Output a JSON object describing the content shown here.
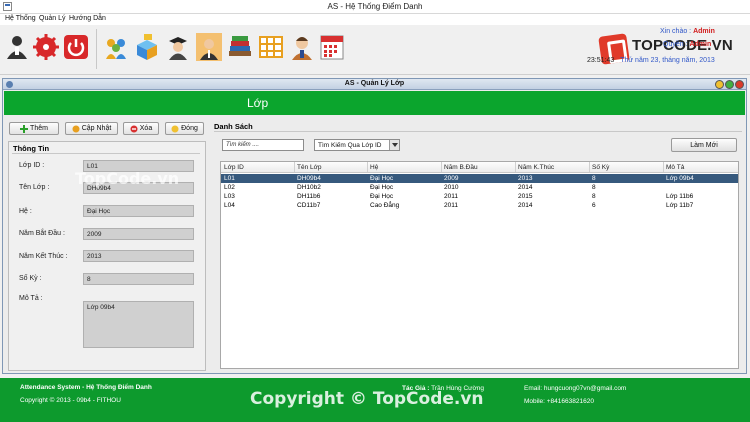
{
  "window": {
    "title": "AS - Hệ Thống Điểm Danh"
  },
  "menu": [
    "Hệ Thống",
    "Quản Lý",
    "Hướng Dẫn"
  ],
  "toolbar": {
    "group1": [
      {
        "name": "user-icon",
        "color": "#333333"
      },
      {
        "name": "settings-icon",
        "color": "#d8282a"
      },
      {
        "name": "power-icon",
        "color": "#d8282a"
      }
    ],
    "group2": [
      {
        "name": "users-group-icon",
        "color": "#e8a820"
      },
      {
        "name": "boxes-icon",
        "color": "#3a8ad8"
      },
      {
        "name": "student-icon",
        "color": "#444444"
      },
      {
        "name": "teacher-icon",
        "color": "#d88820"
      },
      {
        "name": "books-icon",
        "color": "#8a5a30"
      },
      {
        "name": "grid-table-icon",
        "color": "#e8a020"
      },
      {
        "name": "person-icon",
        "color": "#c07030"
      },
      {
        "name": "calendar-icon",
        "color": "#d83030"
      }
    ]
  },
  "brand": {
    "name": "TOPCODE.VN"
  },
  "greeting": {
    "hello_label": "Xin chào :",
    "hello_user": "Admin",
    "role_label": "Quyền :",
    "role_value": "Admin",
    "time": "23:51:43",
    "date": "Thứ năm  23, tháng năm,   2013"
  },
  "inner": {
    "title": "AS - Quản Lý Lớp",
    "heading": "Lớp"
  },
  "actions": {
    "add": "Thêm",
    "update": "Cập Nhật",
    "delete": "Xóa",
    "close": "Đóng"
  },
  "info": {
    "legend": "Thông Tin",
    "fields": [
      {
        "label": "Lớp ID :",
        "value": "L01"
      },
      {
        "label": "Tên Lớp :",
        "value": "DH09b4"
      },
      {
        "label": "Hệ :",
        "value": "Đại Học"
      },
      {
        "label": "Năm Bắt Đầu :",
        "value": "2009"
      },
      {
        "label": "Năm Kết Thúc :",
        "value": "2013"
      },
      {
        "label": "Số Kỳ :",
        "value": "8"
      },
      {
        "label": "Mô Tả :",
        "value": "Lớp 09b4"
      }
    ]
  },
  "list": {
    "title": "Danh Sách",
    "search_placeholder": "Tìm kiếm ....",
    "filter": "Tìm Kiếm Qua Lớp ID",
    "refresh": "Làm Mới",
    "columns": [
      "Lớp ID",
      "Tên Lớp",
      "Hệ",
      "Năm B.Đầu",
      "Năm K.Thúc",
      "Số Kỳ",
      "Mô Tả"
    ],
    "rows": [
      [
        "L01",
        "DH09b4",
        "Đại Học",
        "2009",
        "2013",
        "8",
        "Lớp 09b4"
      ],
      [
        "L02",
        "DH10b2",
        "Đại Học",
        "2010",
        "2014",
        "8",
        ""
      ],
      [
        "L03",
        "DH11b6",
        "Đại Học",
        "2011",
        "2015",
        "8",
        "Lớp 11b6"
      ],
      [
        "L04",
        "CD11b7",
        "Cao Đẳng",
        "2011",
        "2014",
        "6",
        "Lớp 11b7"
      ]
    ],
    "selected_row": 0
  },
  "footer": {
    "system": "Attendance System - Hệ Thống Điểm Danh",
    "copyright": "Copyright © 2013 - 09b4 - FITHOU",
    "author_label": "Tác Giả :",
    "author": "Trần Hùng Cường",
    "email": "Email: hungcuong07vn@gmail.com",
    "mobile": "Mobile: +841663821620"
  },
  "watermark": "Copyright © TopCode.vn",
  "watermark_small": "TopCode.vn"
}
